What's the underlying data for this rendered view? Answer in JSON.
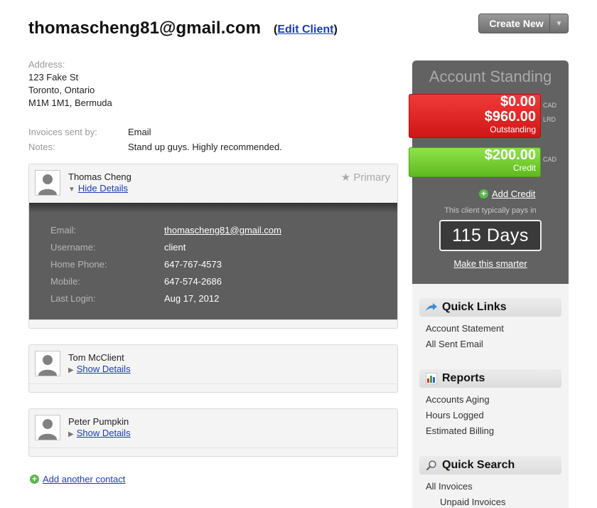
{
  "header": {
    "title": "thomascheng81@gmail.com",
    "edit_open": "(",
    "edit_label": "Edit Client",
    "edit_close": ")",
    "create_new": "Create New"
  },
  "address": {
    "label": "Address:",
    "line1": "123 Fake St",
    "line2": "Toronto, Ontario",
    "line3": "M1M 1M1, Bermuda"
  },
  "info": {
    "invoices_label": "Invoices sent by:",
    "invoices_value": "Email",
    "notes_label": "Notes:",
    "notes_value": "Stand up guys. Highly recommended."
  },
  "contacts": [
    {
      "name": "Thomas Cheng",
      "toggle": "Hide Details",
      "primary": "★ Primary",
      "details": {
        "email_label": "Email:",
        "email_value": "thomascheng81@gmail.com",
        "username_label": "Username:",
        "username_value": "client",
        "home_label": "Home Phone:",
        "home_value": "647-767-4573",
        "mobile_label": "Mobile:",
        "mobile_value": "647-574-2686",
        "login_label": "Last Login:",
        "login_value": "Aug 17, 2012"
      }
    },
    {
      "name": "Tom McClient",
      "toggle": "Show Details"
    },
    {
      "name": "Peter Pumpkin",
      "toggle": "Show Details"
    }
  ],
  "add_contact": "Add another contact",
  "standing": {
    "title": "Account Standing",
    "outstanding_cad": "$0.00",
    "outstanding_lrd": "$960.00",
    "outstanding_label": "Outstanding",
    "credit_amount": "$200.00",
    "credit_label": "Credit",
    "cur_cad": "CAD",
    "cur_lrd": "LRD",
    "add_credit": "Add Credit",
    "pays_text": "This client typically pays in",
    "days": "115 Days",
    "smarter": "Make this smarter"
  },
  "quick_links": {
    "title": "Quick Links",
    "items": [
      "Account Statement",
      "All Sent Email"
    ]
  },
  "reports": {
    "title": "Reports",
    "items": [
      "Accounts Aging",
      "Hours Logged",
      "Estimated Billing"
    ]
  },
  "quick_search": {
    "title": "Quick Search",
    "items": [
      "All Invoices",
      "Unpaid Invoices"
    ]
  },
  "colors": {
    "link": "#1a3db8",
    "outstanding": "#e02020",
    "credit": "#6cc828",
    "standing_bg": "#626262"
  }
}
